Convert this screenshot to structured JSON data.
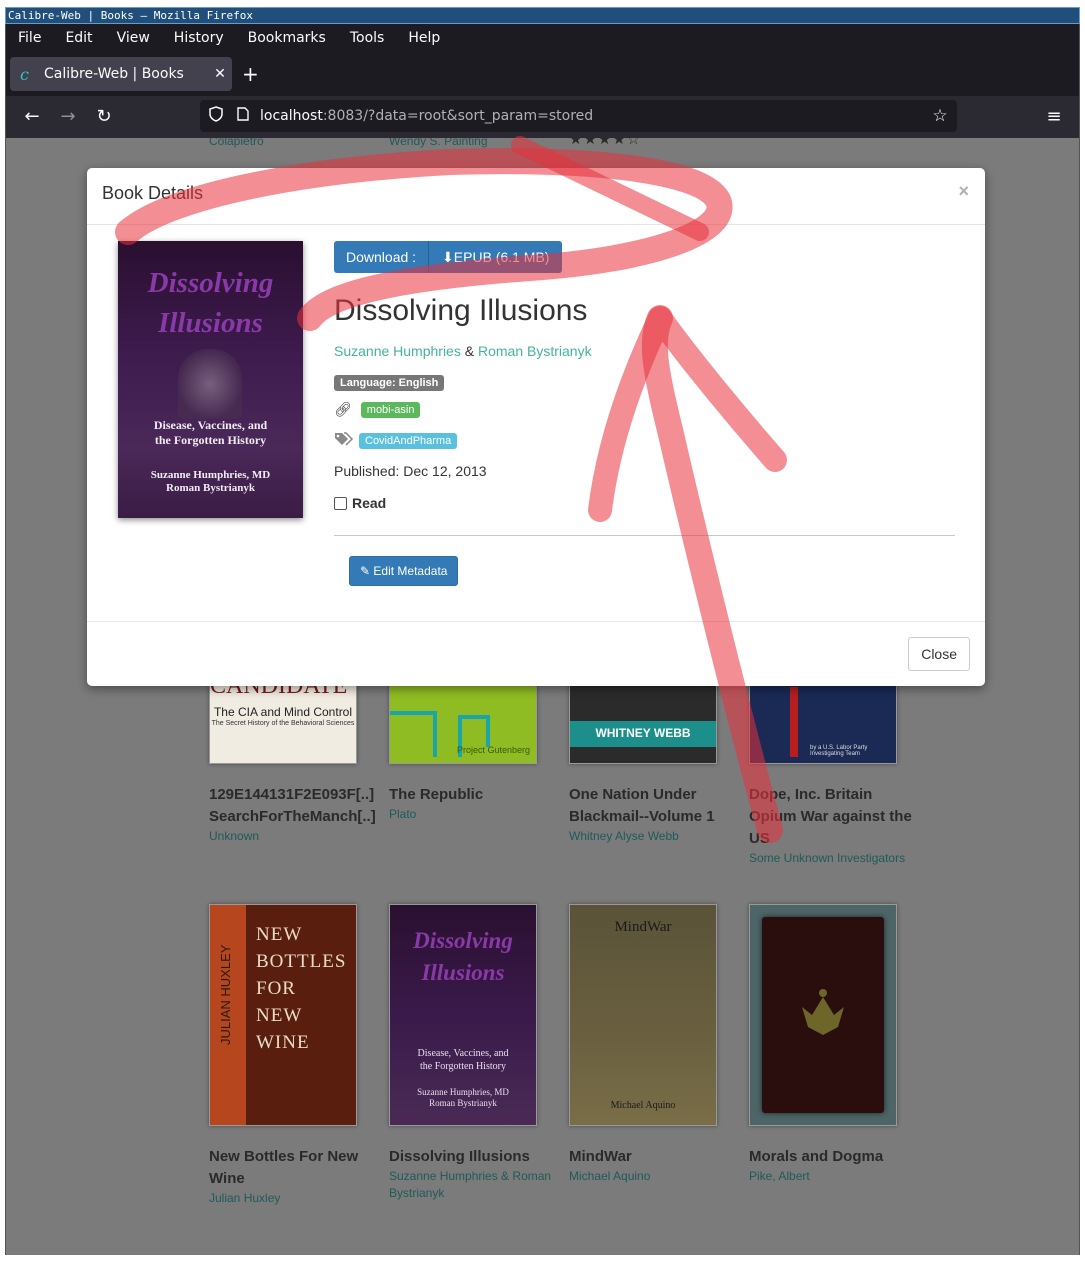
{
  "window": {
    "title": "Calibre-Web | Books — Mozilla Firefox"
  },
  "menu": [
    "File",
    "Edit",
    "View",
    "History",
    "Bookmarks",
    "Tools",
    "Help"
  ],
  "tab": {
    "title": "Calibre-Web | Books",
    "icon": "calibre-icon"
  },
  "url": {
    "host": "localhost",
    "rest": ":8083/?data=root&sort_param=stored"
  },
  "top_strip": {
    "author_left": "Colapietro",
    "author_mid": "Wendy S. Painting",
    "stars": "★★★★☆"
  },
  "modal": {
    "header": "Book Details",
    "close_x": "×",
    "download_label": "Download :",
    "download_epub": "EPUB (6.1 MB)",
    "title": "Dissolving Illusions",
    "author1": "Suzanne Humphries",
    "author_sep": "&",
    "author2": "Roman Bystrianyk",
    "language_badge": "Language: English",
    "identifier": "mobi-asin",
    "tag": "CovidAndPharma",
    "published": "Published: Dec 12, 2013",
    "read_label": "Read",
    "edit_button": "Edit Metadata",
    "close_button": "Close",
    "cover": {
      "title_line1": "Dissolving",
      "title_line2": "Illusions",
      "subtitle1": "Disease, Vaccines, and",
      "subtitle2": "the Forgotten History",
      "author1": "Suzanne Humphries, MD",
      "author2": "Roman Bystrianyk"
    }
  },
  "books_row1": [
    {
      "title": "129E144131F2E093F[..] SearchForTheManch[..]",
      "author": "Unknown",
      "cover_text1": "CANDIDATE\"",
      "cover_text2": "The CIA and Mind Control",
      "cover_text3": "The Secret History of the Behavioral Sciences"
    },
    {
      "title": "The Republic",
      "author": "Plato",
      "cover_text1": "Project Gutenberg"
    },
    {
      "title": "One Nation Under Blackmail--Volume 1",
      "author": "Whitney Alyse Webb",
      "cover_text1": "WHITNEY WEBB"
    },
    {
      "title": "Dope, Inc. Britain Opium War against the US",
      "author": "Some Unknown Investigators",
      "cover_text1": "by a U.S. Labor Party Investigating Team"
    }
  ],
  "books_row2": [
    {
      "title": "New Bottles For New Wine",
      "author": "Julian Huxley",
      "cover_text1": "NEW",
      "cover_text2": "BOTTLES",
      "cover_text3": "FOR",
      "cover_text4": "NEW",
      "cover_text5": "WINE",
      "cover_text6": "JULIAN HUXLEY"
    },
    {
      "title": "Dissolving Illusions",
      "author": "Suzanne Humphries & Roman Bystrianyk"
    },
    {
      "title": "MindWar",
      "author": "Michael Aquino",
      "cover_text1": "MindWar",
      "cover_text2": "Michael Aquino"
    },
    {
      "title": "Morals and Dogma",
      "author": "Pike, Albert"
    }
  ],
  "colors": {
    "accent_link": "#45b29d",
    "primary_button": "#337ab7",
    "annotation": "#e8323c"
  }
}
